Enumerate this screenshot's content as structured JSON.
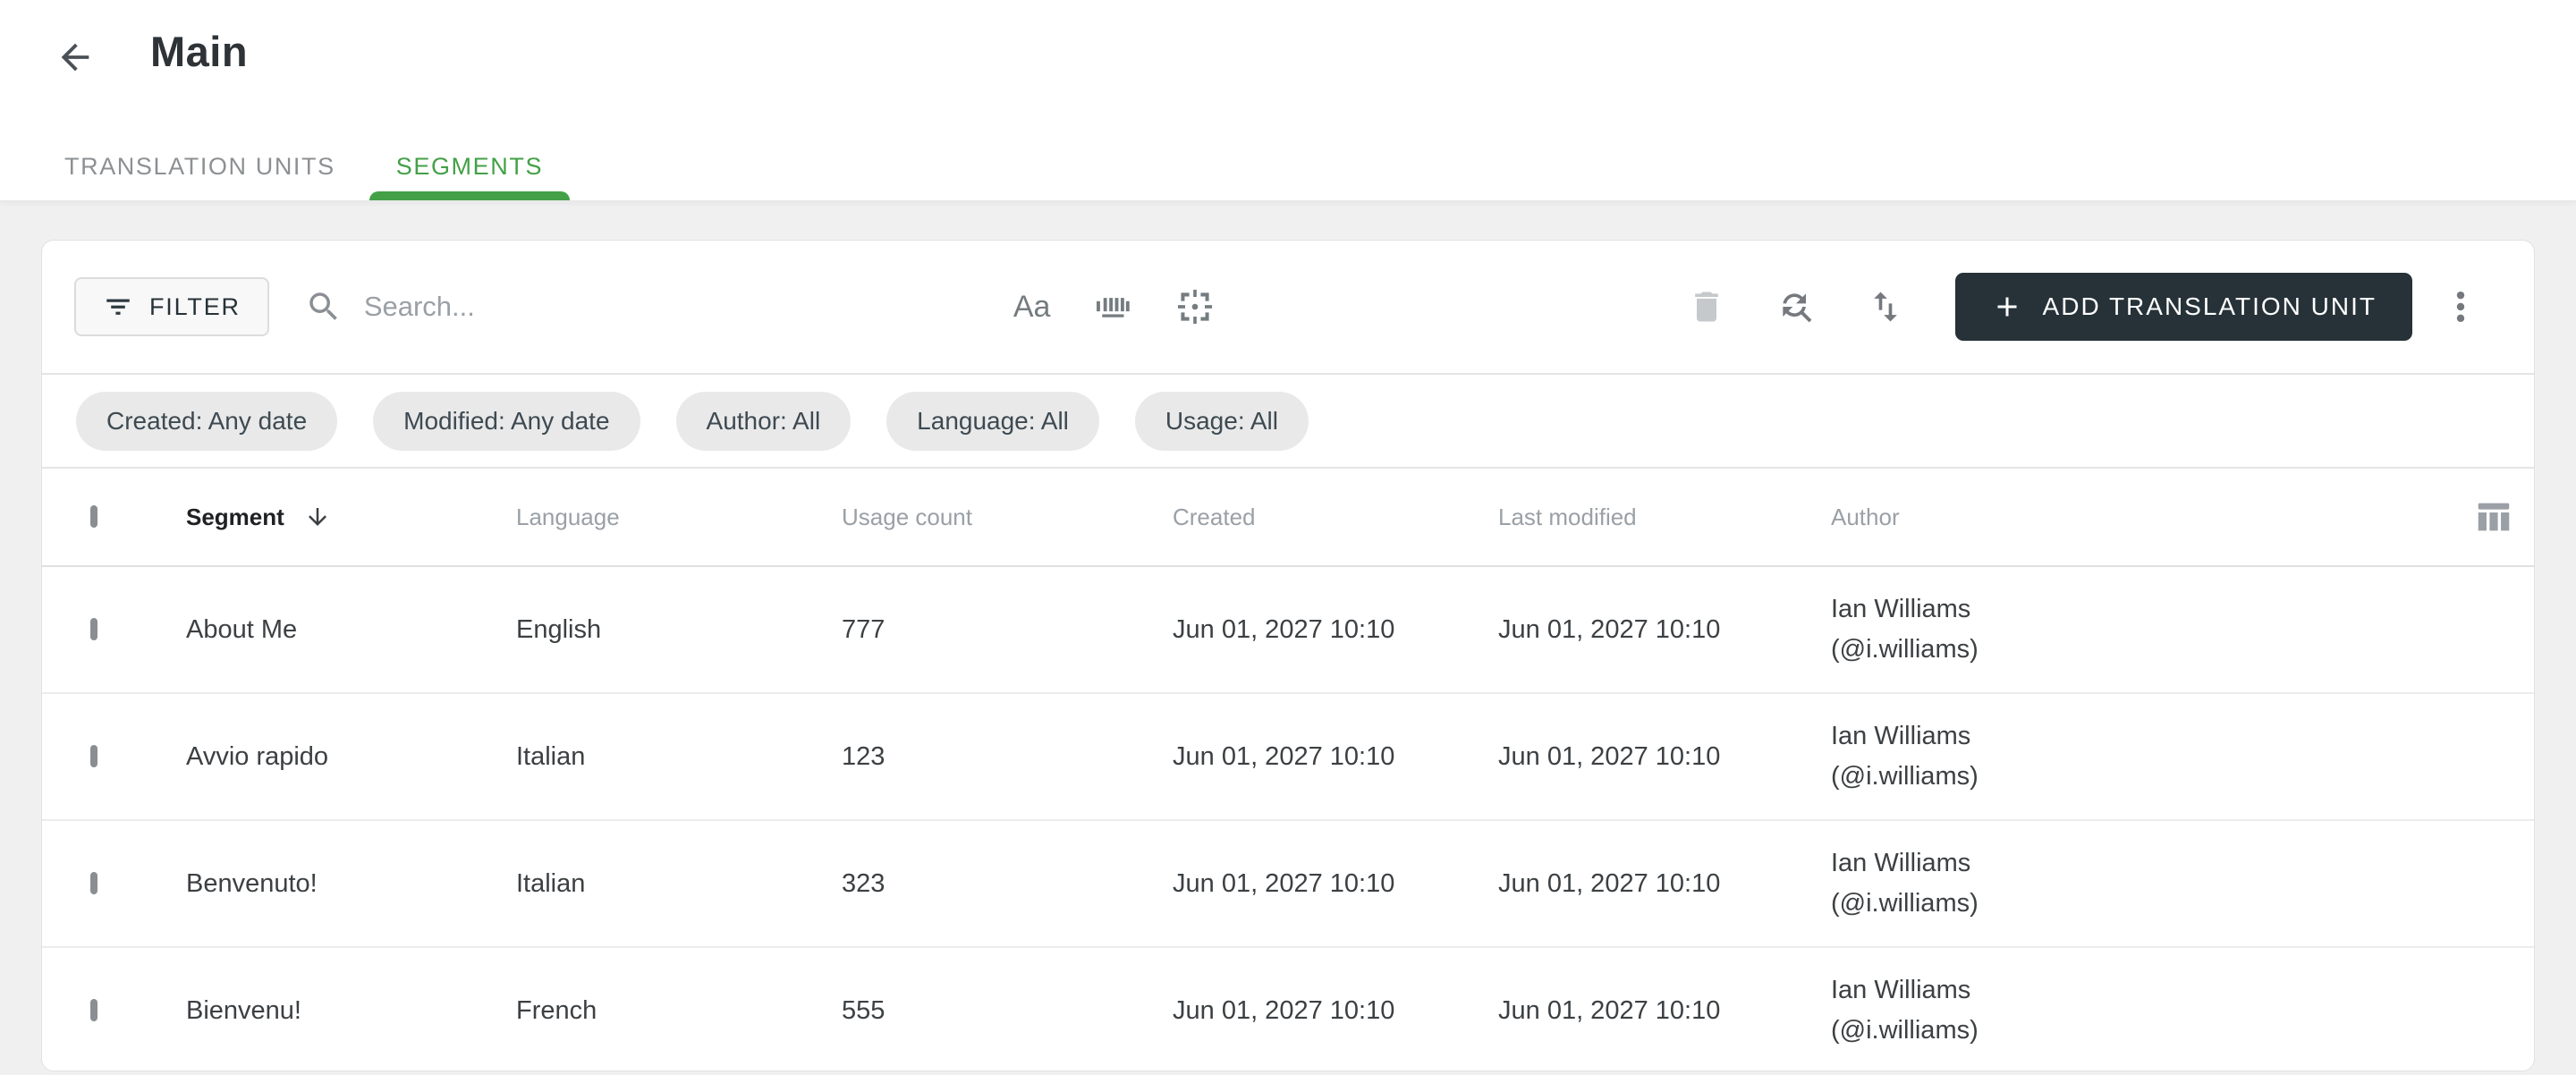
{
  "page": {
    "title": "Main"
  },
  "tabs": [
    {
      "label": "TRANSLATION UNITS",
      "active": false
    },
    {
      "label": "SEGMENTS",
      "active": true
    }
  ],
  "toolbar": {
    "filter_label": "FILTER",
    "search_placeholder": "Search...",
    "match_case_icon_text": "Aa",
    "add_button_label": "ADD TRANSLATION UNIT"
  },
  "filter_chips": [
    {
      "label": "Created: Any date"
    },
    {
      "label": "Modified: Any date"
    },
    {
      "label": "Author: All"
    },
    {
      "label": "Language: All"
    },
    {
      "label": "Usage: All"
    }
  ],
  "table": {
    "columns": {
      "segment": "Segment",
      "language": "Language",
      "usage_count": "Usage count",
      "created": "Created",
      "last_modified": "Last modified",
      "author": "Author"
    },
    "sort": {
      "column": "Segment",
      "arrow": "down"
    },
    "rows": [
      {
        "segment": "About Me",
        "language": "English",
        "usage_count": "777",
        "created": "Jun 01, 2027 10:10",
        "last_modified": "Jun 01, 2027 10:10",
        "author_name": "Ian Williams",
        "author_handle": "(@i.williams)"
      },
      {
        "segment": "Avvio rapido",
        "language": "Italian",
        "usage_count": "123",
        "created": "Jun 01, 2027 10:10",
        "last_modified": "Jun 01, 2027 10:10",
        "author_name": "Ian Williams",
        "author_handle": "(@i.williams)"
      },
      {
        "segment": "Benvenuto!",
        "language": "Italian",
        "usage_count": "323",
        "created": "Jun 01, 2027 10:10",
        "last_modified": "Jun 01, 2027 10:10",
        "author_name": "Ian Williams",
        "author_handle": "(@i.williams)"
      },
      {
        "segment": "Bienvenu!",
        "language": "French",
        "usage_count": "555",
        "created": "Jun 01, 2027 10:10",
        "last_modified": "Jun 01, 2027 10:10",
        "author_name": "Ian Williams",
        "author_handle": "(@i.williams)"
      }
    ]
  },
  "colors": {
    "accent_green": "#43a047",
    "primary_button_bg": "#263238",
    "chip_bg": "#e9e9ea",
    "page_bg": "#f0f0f1"
  }
}
